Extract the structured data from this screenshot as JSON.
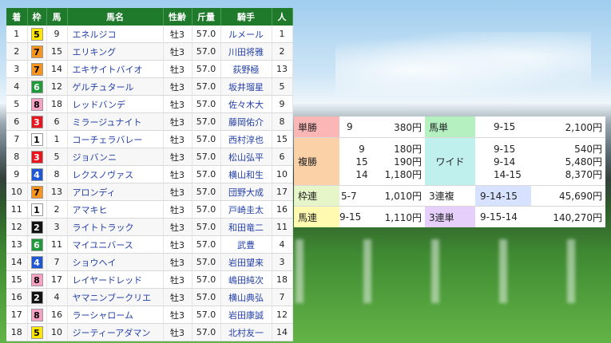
{
  "headers": {
    "rank": "着",
    "frame": "枠",
    "num": "馬",
    "name": "馬名",
    "sexage": "性齢",
    "weight": "斤量",
    "jockey": "騎手",
    "pop": "人"
  },
  "rows": [
    {
      "rank": "1",
      "frame": "5",
      "num": "9",
      "name": "エネルジコ",
      "sexage": "牡3",
      "weight": "57.0",
      "jockey": "ルメール",
      "pop": "1"
    },
    {
      "rank": "2",
      "frame": "7",
      "num": "15",
      "name": "エリキング",
      "sexage": "牡3",
      "weight": "57.0",
      "jockey": "川田将雅",
      "pop": "2"
    },
    {
      "rank": "3",
      "frame": "7",
      "num": "14",
      "name": "エキサイトバイオ",
      "sexage": "牡3",
      "weight": "57.0",
      "jockey": "荻野極",
      "pop": "13"
    },
    {
      "rank": "4",
      "frame": "6",
      "num": "12",
      "name": "ゲルチュタール",
      "sexage": "牡3",
      "weight": "57.0",
      "jockey": "坂井瑠星",
      "pop": "5"
    },
    {
      "rank": "5",
      "frame": "8",
      "num": "18",
      "name": "レッドバンデ",
      "sexage": "牡3",
      "weight": "57.0",
      "jockey": "佐々木大",
      "pop": "9"
    },
    {
      "rank": "6",
      "frame": "3",
      "num": "6",
      "name": "ミラージュナイト",
      "sexage": "牡3",
      "weight": "57.0",
      "jockey": "藤岡佑介",
      "pop": "8"
    },
    {
      "rank": "7",
      "frame": "1",
      "num": "1",
      "name": "コーチェラバレー",
      "sexage": "牡3",
      "weight": "57.0",
      "jockey": "西村淳也",
      "pop": "15"
    },
    {
      "rank": "8",
      "frame": "3",
      "num": "5",
      "name": "ジョバンニ",
      "sexage": "牡3",
      "weight": "57.0",
      "jockey": "松山弘平",
      "pop": "6"
    },
    {
      "rank": "9",
      "frame": "4",
      "num": "8",
      "name": "レクスノヴァス",
      "sexage": "牡3",
      "weight": "57.0",
      "jockey": "横山和生",
      "pop": "10"
    },
    {
      "rank": "10",
      "frame": "7",
      "num": "13",
      "name": "アロンディ",
      "sexage": "牡3",
      "weight": "57.0",
      "jockey": "団野大成",
      "pop": "17"
    },
    {
      "rank": "11",
      "frame": "1",
      "num": "2",
      "name": "アマキヒ",
      "sexage": "牡3",
      "weight": "57.0",
      "jockey": "戸崎圭太",
      "pop": "16"
    },
    {
      "rank": "12",
      "frame": "2",
      "num": "3",
      "name": "ライトトラック",
      "sexage": "牡3",
      "weight": "57.0",
      "jockey": "和田竜二",
      "pop": "11"
    },
    {
      "rank": "13",
      "frame": "6",
      "num": "11",
      "name": "マイユニバース",
      "sexage": "牡3",
      "weight": "57.0",
      "jockey": "武豊",
      "pop": "4"
    },
    {
      "rank": "14",
      "frame": "4",
      "num": "7",
      "name": "ショウヘイ",
      "sexage": "牡3",
      "weight": "57.0",
      "jockey": "岩田望来",
      "pop": "3"
    },
    {
      "rank": "15",
      "frame": "8",
      "num": "17",
      "name": "レイヤードレッド",
      "sexage": "牡3",
      "weight": "57.0",
      "jockey": "嶋田純次",
      "pop": "18"
    },
    {
      "rank": "16",
      "frame": "2",
      "num": "4",
      "name": "ヤマニンブークリエ",
      "sexage": "牡3",
      "weight": "57.0",
      "jockey": "横山典弘",
      "pop": "7"
    },
    {
      "rank": "17",
      "frame": "8",
      "num": "16",
      "name": "ラーシャローム",
      "sexage": "牡3",
      "weight": "57.0",
      "jockey": "岩田康誠",
      "pop": "12"
    },
    {
      "rank": "18",
      "frame": "5",
      "num": "10",
      "name": "ジーティーアダマン",
      "sexage": "牡3",
      "weight": "57.0",
      "jockey": "北村友一",
      "pop": "14"
    }
  ],
  "frame_colors": {
    "1": {
      "bg": "#ffffff",
      "fg": "#000000"
    },
    "2": {
      "bg": "#111111",
      "fg": "#ffffff"
    },
    "3": {
      "bg": "#e8141e",
      "fg": "#ffffff"
    },
    "4": {
      "bg": "#1f56d6",
      "fg": "#ffffff"
    },
    "5": {
      "bg": "#ffe600",
      "fg": "#000000"
    },
    "6": {
      "bg": "#1e9a3a",
      "fg": "#ffffff"
    },
    "7": {
      "bg": "#f7941d",
      "fg": "#000000"
    },
    "8": {
      "bg": "#f7a1c4",
      "fg": "#000000"
    }
  },
  "payout": {
    "tansho": {
      "label": "単勝",
      "num": "9",
      "amount": "380円"
    },
    "umatan": {
      "label": "馬単",
      "combo": "9-15",
      "amount": "2,100円"
    },
    "fukusho": {
      "label": "複勝",
      "nums": [
        "9",
        "15",
        "14"
      ],
      "amounts": [
        "180円",
        "190円",
        "1,180円"
      ]
    },
    "wide": {
      "label": "ワイド",
      "combos": [
        "9-15",
        "9-14",
        "14-15"
      ],
      "amounts": [
        "540円",
        "5,480円",
        "8,370円"
      ]
    },
    "wakuren": {
      "label": "枠連",
      "combo": "5-7",
      "amount": "1,010円"
    },
    "sanrenpuku": {
      "label": "3連複",
      "combo": "9-14-15",
      "amount": "45,690円"
    },
    "umaren": {
      "label": "馬連",
      "combo": "9-15",
      "amount": "1,110円"
    },
    "sanrentan": {
      "label": "3連単",
      "combo": "9-15-14",
      "amount": "140,270円"
    }
  },
  "colors": {
    "header_green": "#1f7a2c",
    "tansho_bg": "#fbb6b6",
    "fukusho_bg": "#fbd1a8",
    "umatan_bg": "#b5f0c0",
    "wide_bg": "#bff0ee",
    "wakuren_bg": "#e7f6c9",
    "sanrenpuku_bg": "#d6e2ff",
    "umaren_bg": "#fffab0",
    "sanrentan_bg": "#e6d0fb"
  }
}
